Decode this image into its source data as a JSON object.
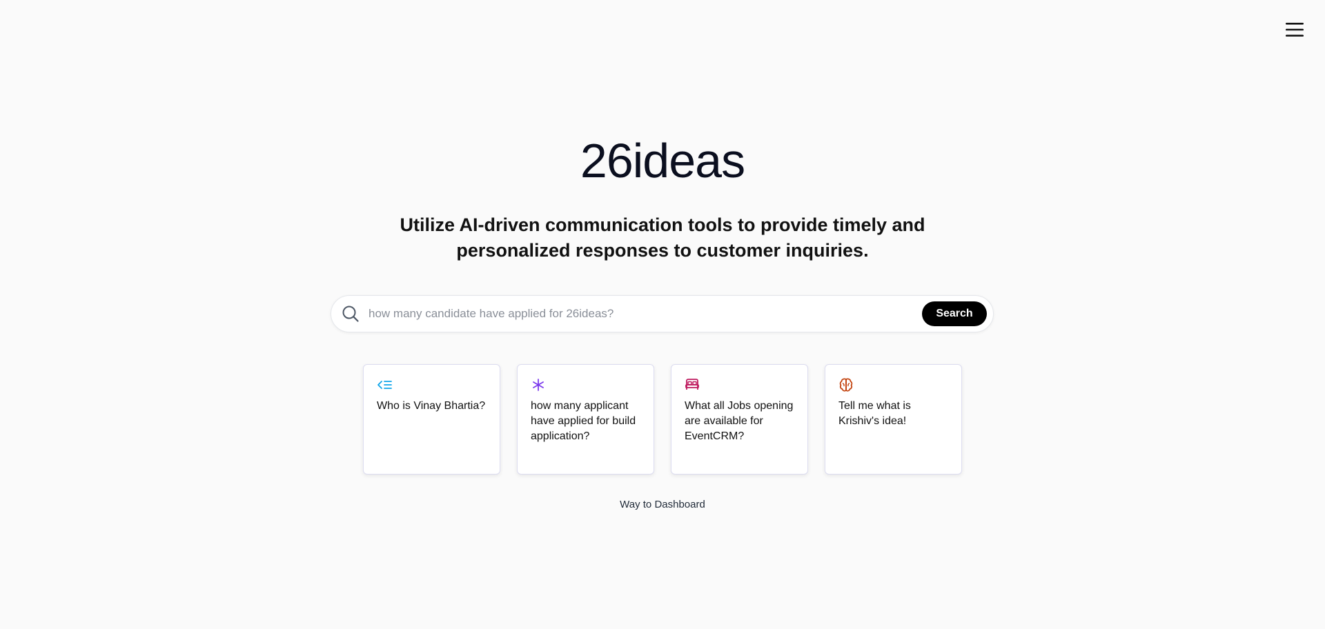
{
  "header": {
    "menu_icon": "hamburger-menu-icon"
  },
  "hero": {
    "title": "26ideas",
    "subtitle": "Utilize AI-driven communication tools to provide timely and personalized responses to customer inquiries."
  },
  "search": {
    "icon": "search-icon",
    "placeholder": "how many candidate have applied for 26ideas?",
    "value": "",
    "button_label": "Search"
  },
  "suggestions": [
    {
      "icon": "list-indent-icon",
      "color": "#0ea5e9",
      "text": "Who is Vinay Bhartia?"
    },
    {
      "icon": "asterisk-icon",
      "color": "#7c3aed",
      "text": "how many applicant have applied for build application?"
    },
    {
      "icon": "bed-icon",
      "color": "#be185d",
      "text": "What all Jobs opening are available for EventCRM?"
    },
    {
      "icon": "brain-icon",
      "color": "#c2410c",
      "text": "Tell me what is Krishiv's idea!"
    }
  ],
  "footer": {
    "dashboard_link": "Way to Dashboard"
  }
}
